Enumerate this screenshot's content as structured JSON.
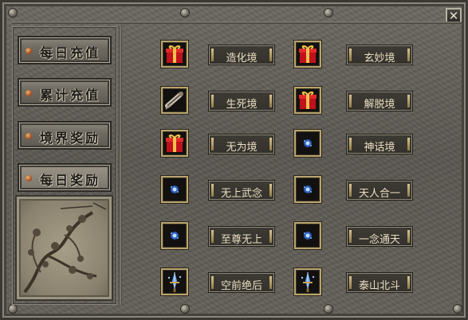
{
  "window": {
    "close_label": "✕"
  },
  "sidebar": {
    "tabs": [
      {
        "label": "每日充值",
        "active": false
      },
      {
        "label": "累计充值",
        "active": false
      },
      {
        "label": "境界奖励",
        "active": false
      },
      {
        "label": "每日奖励",
        "active": true
      }
    ]
  },
  "rewards": [
    {
      "name": "造化境",
      "icon": "gift-box-icon"
    },
    {
      "name": "玄妙境",
      "icon": "gift-box-icon"
    },
    {
      "name": "生死境",
      "icon": "scroll-icon"
    },
    {
      "name": "解脱境",
      "icon": "gift-box-icon"
    },
    {
      "name": "无为境",
      "icon": "gift-box-icon"
    },
    {
      "name": "神话境",
      "icon": "blue-orb-icon"
    },
    {
      "name": "无上武念",
      "icon": "blue-orb-icon"
    },
    {
      "name": "天人合一",
      "icon": "blue-orb-icon"
    },
    {
      "name": "至尊无上",
      "icon": "blue-orb-icon"
    },
    {
      "name": "一念通天",
      "icon": "blue-orb-icon"
    },
    {
      "name": "空前绝后",
      "icon": "crystal-sword-icon"
    },
    {
      "name": "泰山北斗",
      "icon": "crystal-sword-icon"
    }
  ],
  "colors": {
    "slot_border": "#b9a46d",
    "label_text": "#eadfc2"
  }
}
